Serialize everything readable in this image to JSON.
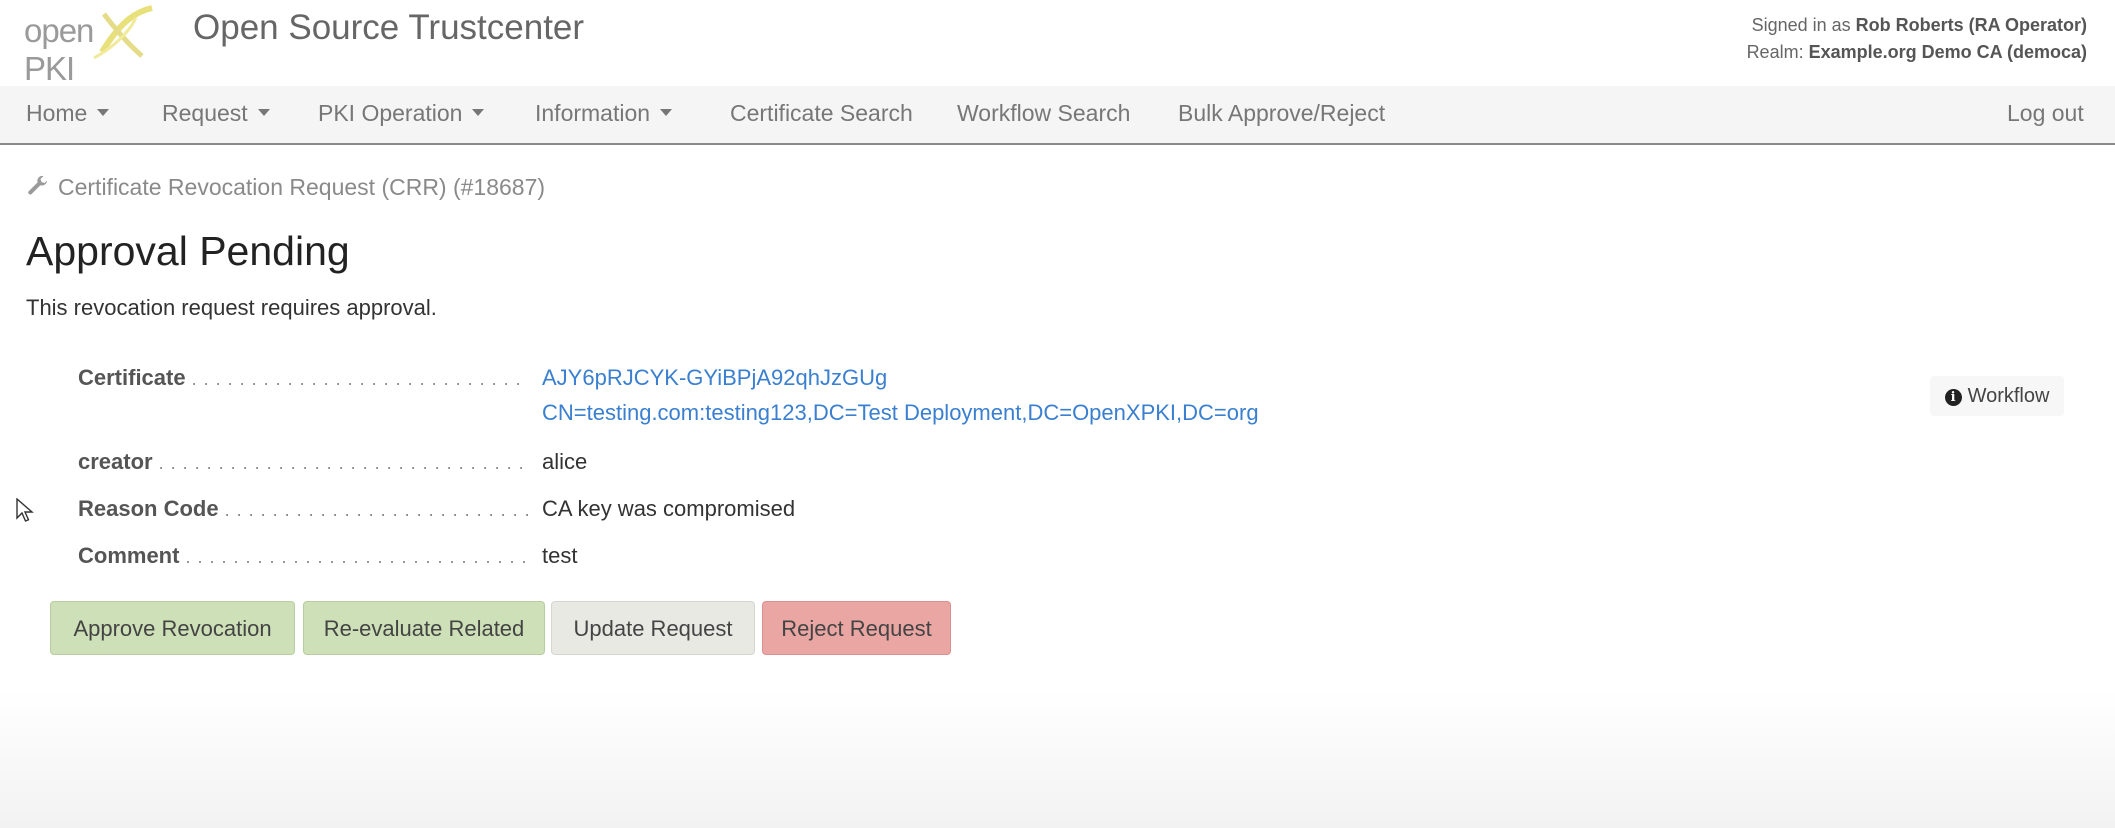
{
  "header": {
    "logo_open": "open",
    "logo_pki": "PKI",
    "title": "Open Source Trustcenter",
    "signed_in_prefix": "Signed in as",
    "signed_in_user": "Rob Roberts (RA Operator)",
    "realm_prefix": "Realm:",
    "realm_value": "Example.org Demo CA (democa)"
  },
  "nav": {
    "items": [
      {
        "label": "Home",
        "dropdown": true
      },
      {
        "label": "Request",
        "dropdown": true
      },
      {
        "label": "PKI Operation",
        "dropdown": true
      },
      {
        "label": "Information",
        "dropdown": true
      },
      {
        "label": "Certificate Search",
        "dropdown": false
      },
      {
        "label": "Workflow Search",
        "dropdown": false
      },
      {
        "label": "Bulk Approve/Reject",
        "dropdown": false
      }
    ],
    "logout": "Log out"
  },
  "breadcrumb": "Certificate Revocation Request (CRR) (#18687)",
  "page": {
    "title": "Approval Pending",
    "description": "This revocation request requires approval."
  },
  "details": {
    "certificate_label": "Certificate",
    "certificate_id": "AJY6pRJCYK-GYiBPjA92qhJzGUg",
    "certificate_dn": "CN=testing.com:testing123,DC=Test Deployment,DC=OpenXPKI,DC=org",
    "creator_label": "creator",
    "creator_value": "alice",
    "reason_label": "Reason Code",
    "reason_value": "CA key was compromised",
    "comment_label": "Comment",
    "comment_value": "test"
  },
  "workflow_button": "Workflow",
  "actions": {
    "approve": "Approve Revocation",
    "reevaluate": "Re-evaluate Related",
    "update": "Update Request",
    "reject": "Reject Request"
  },
  "colors": {
    "link": "#3a7fd0",
    "button_green": "#cde0b7",
    "button_gray": "#e9e9e4",
    "button_red": "#e9a6a3",
    "logo_accent": "#e8e07a"
  }
}
